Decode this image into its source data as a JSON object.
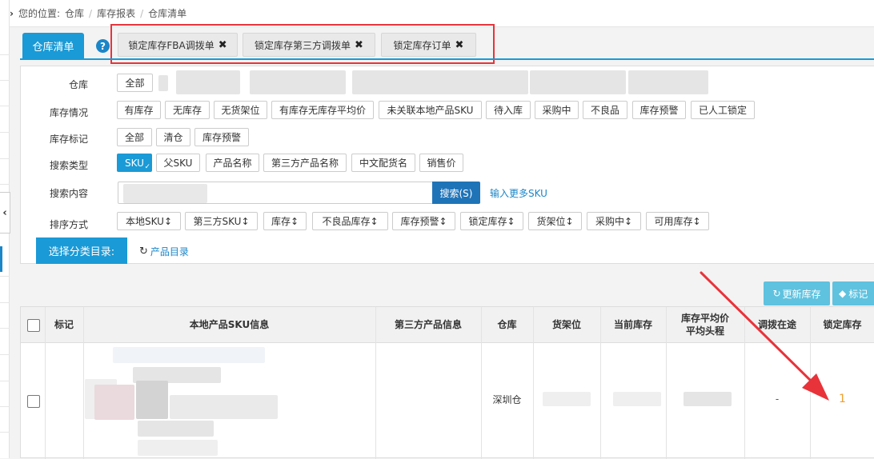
{
  "breadcrumb": {
    "prefix": "您的位置:",
    "items": [
      "仓库",
      "库存报表",
      "仓库清单"
    ]
  },
  "tabs": {
    "active": "仓库清单",
    "locked": [
      {
        "label": "锁定库存FBA调拨单"
      },
      {
        "label": "锁定库存第三方调拨单"
      },
      {
        "label": "锁定库存订单"
      }
    ],
    "close_glyph": "✖"
  },
  "filters": {
    "warehouse": {
      "label": "仓库",
      "options": [
        "全部"
      ]
    },
    "stock_status": {
      "label": "库存情况",
      "options": [
        "有库存",
        "无库存",
        "无货架位",
        "有库存无库存平均价",
        "未关联本地产品SKU",
        "待入库",
        "采购中",
        "不良品",
        "库存预警",
        "已人工锁定"
      ]
    },
    "stock_mark": {
      "label": "库存标记",
      "options": [
        "全部",
        "清仓",
        "库存预警"
      ]
    },
    "search_type": {
      "label": "搜索类型",
      "selected": "SKU",
      "options": [
        "SKU",
        "父SKU",
        "产品名称",
        "第三方产品名称",
        "中文配货名",
        "销售价"
      ]
    },
    "search_content": {
      "label": "搜索内容",
      "button": "搜索(S)",
      "more_link": "输入更多SKU"
    },
    "sort": {
      "label": "排序方式",
      "options": [
        "本地SKU",
        "第三方SKU",
        "库存",
        "不良品库存",
        "库存预警",
        "锁定库存",
        "货架位",
        "采购中",
        "可用库存"
      ],
      "arrow": "↕"
    }
  },
  "category": {
    "bar_label": "选择分类目录:",
    "link_label": "产品目录"
  },
  "actions": {
    "update_stock": "更新库存",
    "mark": "标记"
  },
  "table": {
    "headers": {
      "mark": "标记",
      "local_sku": "本地产品SKU信息",
      "third_party": "第三方产品信息",
      "warehouse": "仓库",
      "shelf": "货架位",
      "current_stock": "当前库存",
      "avg_price_line1": "库存平均价",
      "avg_price_line2": "平均头程",
      "in_transit": "调拨在途",
      "locked_stock": "锁定库存"
    },
    "rows": [
      {
        "warehouse": "深圳仓",
        "in_transit": "-",
        "locked_stock": "1"
      }
    ]
  },
  "colors": {
    "accent": "#1a9ad6",
    "highlight": "#e8333a",
    "locked_value": "#f0a030"
  }
}
